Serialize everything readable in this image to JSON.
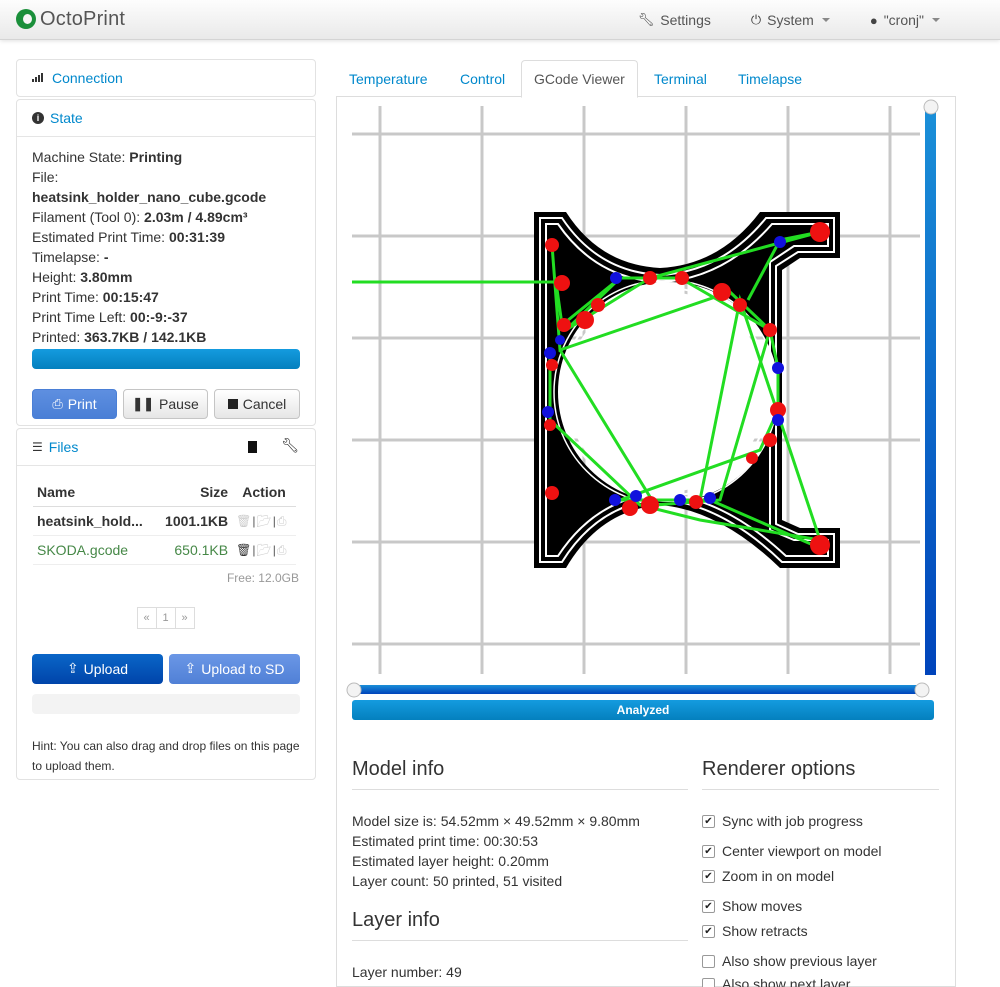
{
  "navbar": {
    "brand": "OctoPrint",
    "settings": "Settings",
    "system": "System",
    "user": "\"cronj\""
  },
  "connection": {
    "title": "Connection"
  },
  "state": {
    "title": "State",
    "machine_state_label": "Machine State:",
    "machine_state": "Printing",
    "file_label": "File:",
    "file": "heatsink_holder_nano_cube.gcode",
    "filament_label": "Filament (Tool 0):",
    "filament": "2.03m / 4.89cm³",
    "est_time_label": "Estimated Print Time:",
    "est_time": "00:31:39",
    "timelapse_label": "Timelapse:",
    "timelapse": "-",
    "height_label": "Height:",
    "height": "3.80mm",
    "print_time_label": "Print Time:",
    "print_time": "00:15:47",
    "time_left_label": "Print Time Left:",
    "time_left": "00:-9:-37",
    "printed_label": "Printed:",
    "printed": "363.7KB / 142.1KB",
    "print_btn": "Print",
    "pause_btn": "Pause",
    "cancel_btn": "Cancel"
  },
  "files": {
    "title": "Files",
    "col_name": "Name",
    "col_size": "Size",
    "col_action": "Action",
    "rows": [
      {
        "name": "heatsink_hold...",
        "size": "1001.1KB"
      },
      {
        "name": "SKODA.gcode",
        "size": "650.1KB"
      }
    ],
    "free": "Free: 12.0GB",
    "pager": [
      "«",
      "1",
      "»"
    ],
    "upload": "Upload",
    "upload_sd": "Upload to SD",
    "hint": "Hint: You can also drag and drop files on this page to upload them."
  },
  "tabs": [
    "Temperature",
    "Control",
    "GCode Viewer",
    "Terminal",
    "Timelapse"
  ],
  "viewer": {
    "analyzed": "Analyzed"
  },
  "model_info": {
    "title": "Model info",
    "lines": [
      "Model size is: 54.52mm × 49.52mm × 9.80mm",
      "Estimated print time: 00:30:53",
      "Estimated layer height: 0.20mm",
      "Layer count: 50 printed, 51 visited"
    ]
  },
  "layer_info": {
    "title": "Layer info",
    "layer_number": "Layer number: 49"
  },
  "renderer": {
    "title": "Renderer options",
    "options": [
      {
        "label": "Sync with job progress",
        "checked": true
      },
      {
        "label": "Center viewport on model",
        "checked": true
      },
      {
        "label": "Zoom in on model",
        "checked": true
      },
      {
        "label": "Show moves",
        "checked": true
      },
      {
        "label": "Show retracts",
        "checked": true
      },
      {
        "label": "Also show previous layer",
        "checked": false
      },
      {
        "label": "Also show next layer",
        "checked": false
      }
    ]
  },
  "colors": {
    "accent": "#0088cc",
    "primary_button": "#4a7fd6",
    "progress": "#0480be",
    "move": "#22dd22",
    "retract": "#ee1111",
    "restart": "#1111dd"
  }
}
